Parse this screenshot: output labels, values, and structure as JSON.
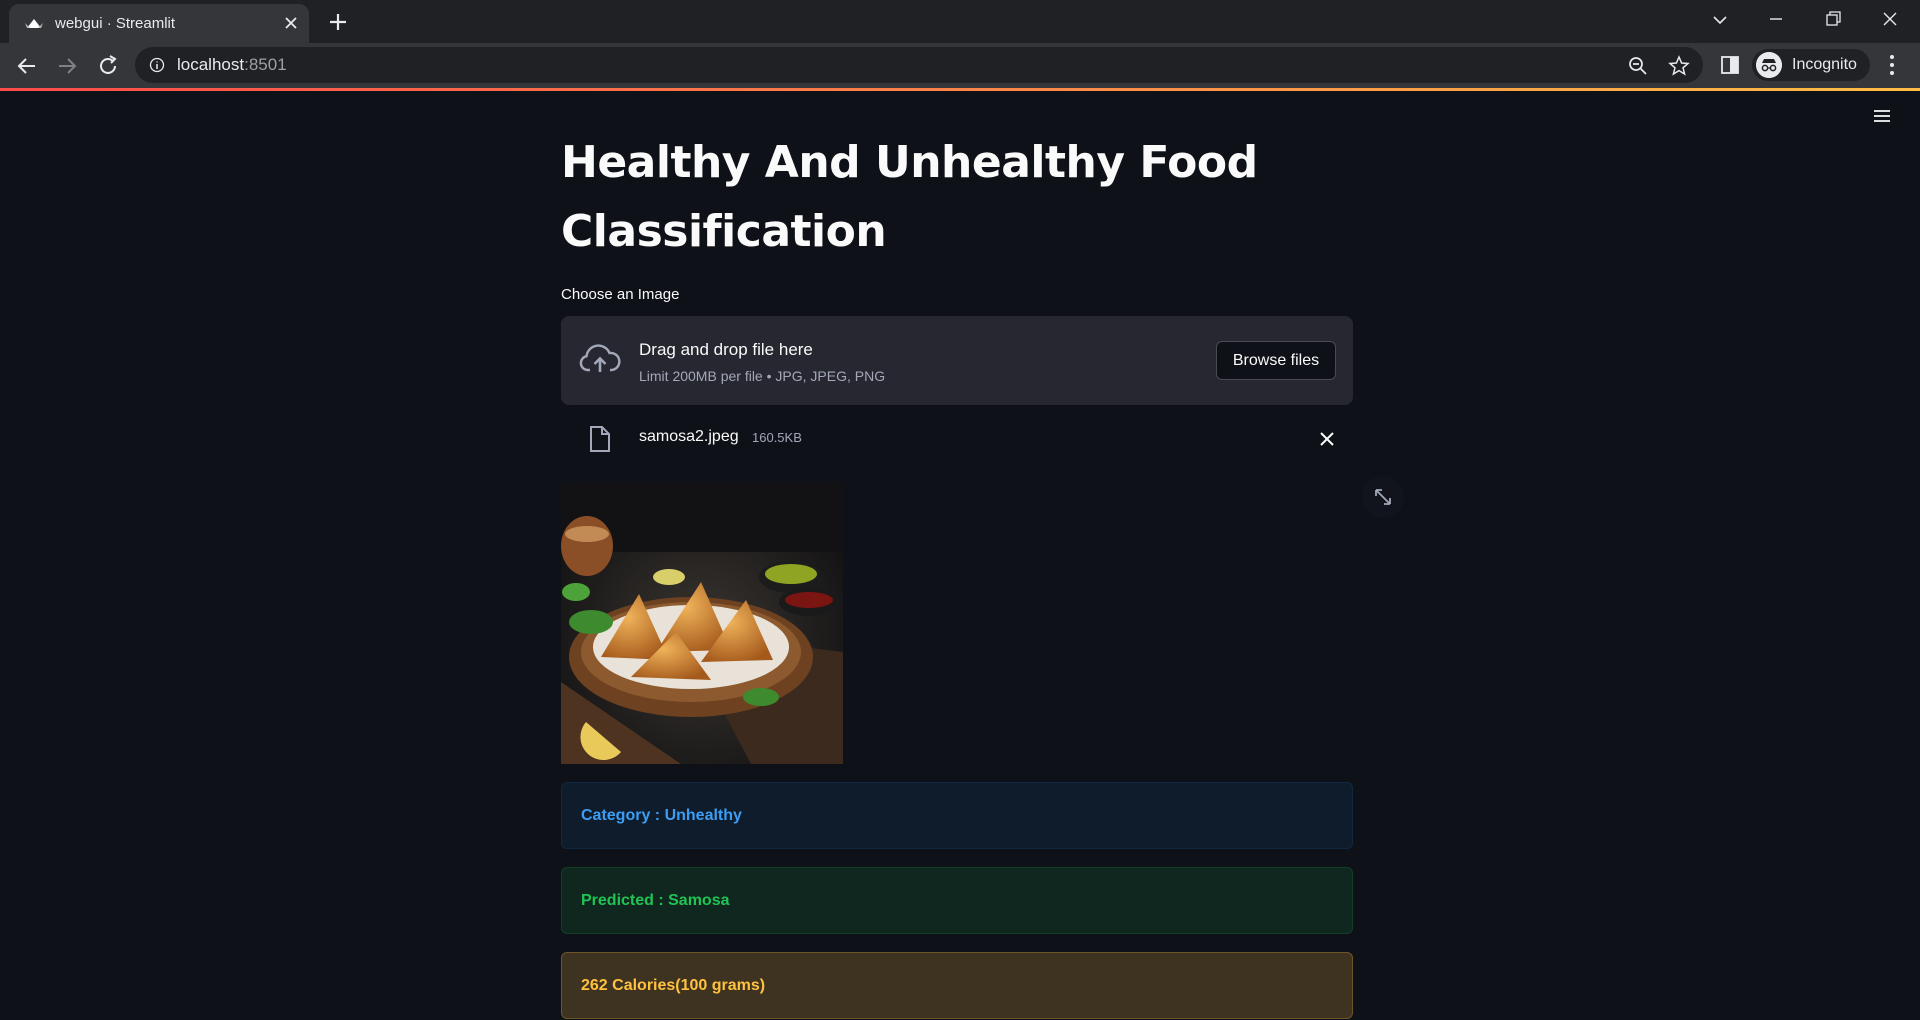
{
  "browser": {
    "tab_title": "webgui · Streamlit",
    "url_host": "localhost",
    "url_port": ":8501",
    "profile_label": "Incognito"
  },
  "app": {
    "title": "Healthy And Unhealthy Food Classification",
    "uploader": {
      "label": "Choose an Image",
      "drop_title": "Drag and drop file here",
      "drop_subtitle": "Limit 200MB per file • JPG, JPEG, PNG",
      "browse_label": "Browse files"
    },
    "uploaded_file": {
      "name": "samosa2.jpeg",
      "size": "160.5KB"
    },
    "results": {
      "category": "Category : Unhealthy",
      "predicted": "Predicted : Samosa",
      "calories": "262 Calories(100 grams)"
    }
  },
  "colors": {
    "background": "#0e1117",
    "info": "#3d9df3",
    "success": "#21c354",
    "warning": "#ffc13f"
  }
}
